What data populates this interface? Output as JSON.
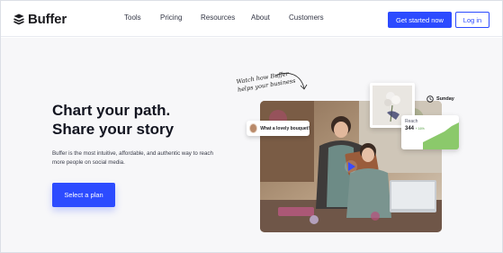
{
  "header": {
    "logo_text": "Buffer",
    "nav": [
      {
        "label": "Tools"
      },
      {
        "label": "Pricing"
      },
      {
        "label": "Resources"
      },
      {
        "label": "About"
      },
      {
        "label": "Customers"
      }
    ],
    "get_started_label": "Get started now",
    "login_label": "Log in"
  },
  "hero": {
    "headline_line1": "Chart your path.",
    "headline_line2": "Share your story",
    "subtext": "Buffer is the most intuitive, affordable, and authentic way to reach more people on social media.",
    "cta_label": "Select a plan",
    "handwritten_line1": "Watch how Buffer",
    "handwritten_line2": "helps your business"
  },
  "overlay": {
    "comment_text": "What a lovely bouquet!",
    "schedule_day": "Sunday",
    "reach_label": "Reach",
    "reach_value": "344",
    "reach_delta": "+ 16%"
  },
  "colors": {
    "brand_blue": "#2c4bff",
    "chart_green": "#8bc96b",
    "page_bg": "#f7f7f9"
  },
  "icons": [
    "buffer-logo-icon",
    "play-icon",
    "clock-icon",
    "arrow-icon"
  ]
}
